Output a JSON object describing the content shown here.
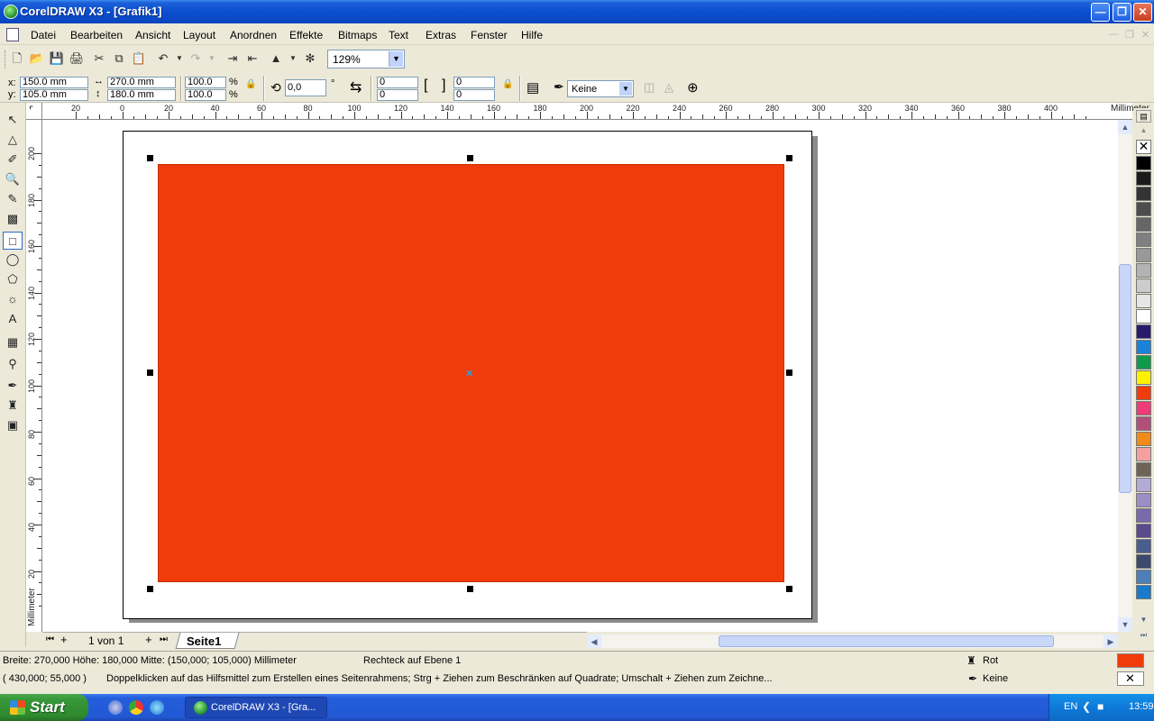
{
  "window": {
    "title": "CorelDRAW X3 - [Grafik1]"
  },
  "menu": [
    "Datei",
    "Bearbeiten",
    "Ansicht",
    "Layout",
    "Anordnen",
    "Effekte",
    "Bitmaps",
    "Text",
    "Extras",
    "Fenster",
    "Hilfe"
  ],
  "toolbar": {
    "zoom": "129%"
  },
  "property_bar": {
    "x_label": "x:",
    "x_value": "150.0 mm",
    "y_label": "y:",
    "y_value": "105.0 mm",
    "width_value": "270.0 mm",
    "height_value": "180.0 mm",
    "scale_x": "100.0",
    "scale_y": "100.0",
    "percent": "%",
    "rotation": "0,0",
    "degree": "°",
    "corner_1": "0",
    "corner_2": "0",
    "corner_3": "0",
    "corner_4": "0",
    "outline": "Keine"
  },
  "ruler": {
    "units": "Millimeter",
    "h_labels": [
      "20",
      "0",
      "20",
      "40",
      "60",
      "80",
      "100",
      "120",
      "140",
      "160",
      "180",
      "200",
      "220",
      "240",
      "260",
      "280",
      "300",
      "320",
      "340",
      "360",
      "380",
      "400"
    ],
    "v_labels": [
      "200",
      "180",
      "160",
      "140",
      "120",
      "100",
      "80",
      "60",
      "40",
      "20"
    ]
  },
  "document": {
    "shape_fill": "#f03c0a",
    "page_label": "1 von 1",
    "page_tab": "Seite1"
  },
  "status": {
    "dimensions": "Breite: 270,000  Höhe: 180,000  Mitte: (150,000; 105,000) Millimeter",
    "object": "Rechteck auf Ebene 1",
    "fill_name": "Rot",
    "outline_name": "Keine",
    "cursor": "( 430,000; 55,000 )",
    "hint": "Doppelklicken auf das Hilfsmittel zum Erstellen eines Seitenrahmens; Strg + Ziehen zum Beschränken auf Quadrate; Umschalt + Ziehen zum Zeichne..."
  },
  "palette": [
    "#000000",
    "#1a1a1a",
    "#333333",
    "#4d4d4d",
    "#666666",
    "#808080",
    "#999999",
    "#b3b3b3",
    "#cccccc",
    "#e6e6e6",
    "#ffffff",
    "#2a1a6e",
    "#1a82d8",
    "#0f9a4a",
    "#fff200",
    "#f03c0a",
    "#ee3c78",
    "#b0507a",
    "#f28a1a",
    "#f5a0a0",
    "#6e6456",
    "#b4aad6",
    "#9a8ec4",
    "#7a6aac",
    "#5a4a8e",
    "#4a5e8e",
    "#3a4a6e",
    "#4e7eb8",
    "#1a7ac8"
  ],
  "taskbar": {
    "start": "Start",
    "task": "CorelDRAW X3 - [Gra...",
    "lang": "EN",
    "time": "13:59"
  }
}
